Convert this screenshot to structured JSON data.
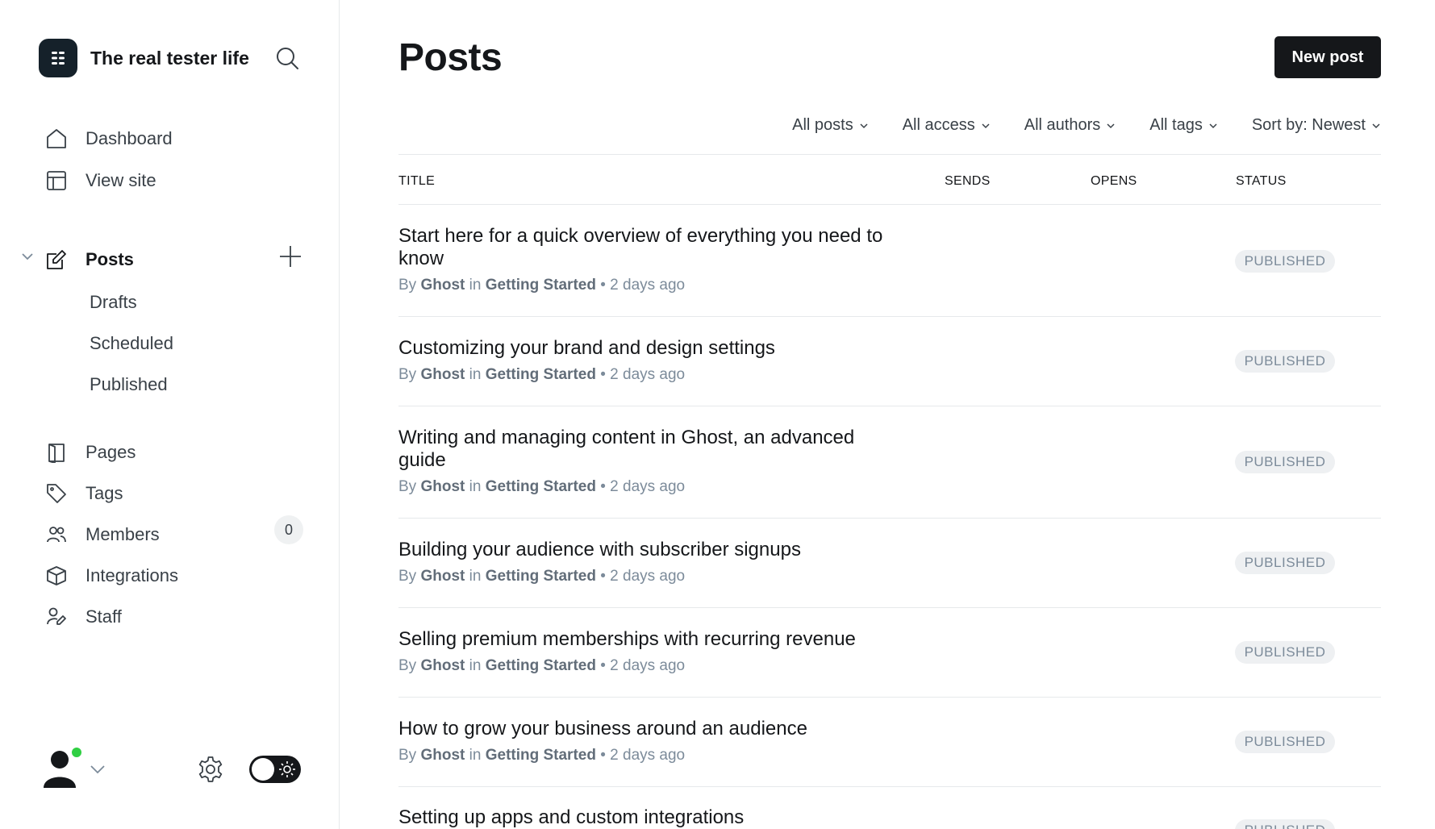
{
  "site": {
    "name": "The real tester life"
  },
  "nav": {
    "dashboard": "Dashboard",
    "view_site": "View site",
    "posts": "Posts",
    "drafts": "Drafts",
    "scheduled": "Scheduled",
    "published": "Published",
    "pages": "Pages",
    "tags": "Tags",
    "members": "Members",
    "members_count": "0",
    "integrations": "Integrations",
    "staff": "Staff"
  },
  "header": {
    "title": "Posts",
    "new_post": "New post"
  },
  "filters": {
    "posts": "All posts",
    "access": "All access",
    "authors": "All authors",
    "tags": "All tags",
    "sort": "Sort by: Newest"
  },
  "table": {
    "columns": {
      "title": "TITLE",
      "sends": "SENDS",
      "opens": "OPENS",
      "status": "STATUS"
    },
    "rows": [
      {
        "title": "Start here for a quick overview of everything you need to know",
        "by": "By",
        "author": "Ghost",
        "in": "in",
        "tag": "Getting Started",
        "time": "• 2 days ago",
        "status": "PUBLISHED"
      },
      {
        "title": "Customizing your brand and design settings",
        "by": "By",
        "author": "Ghost",
        "in": "in",
        "tag": "Getting Started",
        "time": "• 2 days ago",
        "status": "PUBLISHED"
      },
      {
        "title": "Writing and managing content in Ghost, an advanced guide",
        "by": "By",
        "author": "Ghost",
        "in": "in",
        "tag": "Getting Started",
        "time": "• 2 days ago",
        "status": "PUBLISHED"
      },
      {
        "title": "Building your audience with subscriber signups",
        "by": "By",
        "author": "Ghost",
        "in": "in",
        "tag": "Getting Started",
        "time": "• 2 days ago",
        "status": "PUBLISHED"
      },
      {
        "title": "Selling premium memberships with recurring revenue",
        "by": "By",
        "author": "Ghost",
        "in": "in",
        "tag": "Getting Started",
        "time": "• 2 days ago",
        "status": "PUBLISHED"
      },
      {
        "title": "How to grow your business around an audience",
        "by": "By",
        "author": "Ghost",
        "in": "in",
        "tag": "Getting Started",
        "time": "• 2 days ago",
        "status": "PUBLISHED"
      },
      {
        "title": "Setting up apps and custom integrations",
        "status": "PUBLISHED"
      }
    ]
  },
  "colors": {
    "accent": "#15171a",
    "online": "#30cf43",
    "status_bg": "#eef0f2",
    "muted": "#7c8b9a"
  },
  "icons": [
    "ghost-logo-icon",
    "search-icon",
    "home-icon",
    "layout-icon",
    "edit-icon",
    "plus-icon",
    "chevron-down-icon",
    "page-icon",
    "tag-icon",
    "members-icon",
    "box-icon",
    "staff-icon",
    "user-avatar-icon",
    "gear-icon",
    "sun-icon"
  ]
}
